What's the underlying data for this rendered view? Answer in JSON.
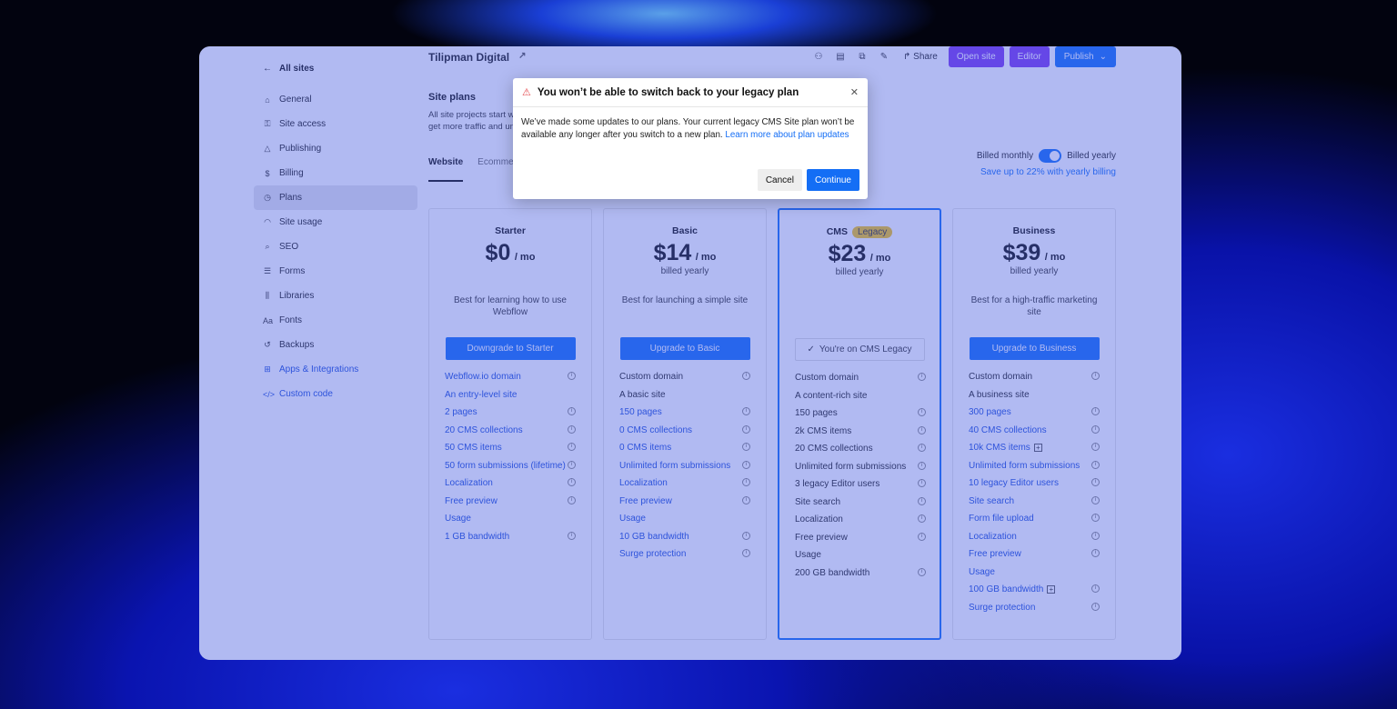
{
  "sidebar": {
    "back_label": "All sites",
    "items": [
      {
        "label": "General",
        "icon": "home-icon",
        "glyph": "⌂"
      },
      {
        "label": "Site access",
        "icon": "key-icon",
        "glyph": "⚿"
      },
      {
        "label": "Publishing",
        "icon": "send-icon",
        "glyph": "△"
      },
      {
        "label": "Billing",
        "icon": "dollar-icon",
        "glyph": "$"
      },
      {
        "label": "Plans",
        "icon": "plans-icon",
        "glyph": "◷"
      },
      {
        "label": "Site usage",
        "icon": "gauge-icon",
        "glyph": "◠"
      },
      {
        "label": "SEO",
        "icon": "search-icon",
        "glyph": "⌕"
      },
      {
        "label": "Forms",
        "icon": "forms-icon",
        "glyph": "☰"
      },
      {
        "label": "Libraries",
        "icon": "library-icon",
        "glyph": "⫼"
      },
      {
        "label": "Fonts",
        "icon": "font-icon",
        "glyph": "Aa"
      },
      {
        "label": "Backups",
        "icon": "backup-icon",
        "glyph": "↺"
      },
      {
        "label": "Apps & Integrations",
        "icon": "apps-icon",
        "glyph": "⊞"
      },
      {
        "label": "Custom code",
        "icon": "code-icon",
        "glyph": "</>"
      }
    ]
  },
  "header": {
    "site_name": "Tilipman Digital",
    "share": "Share",
    "open_site": "Open site",
    "editor": "Editor",
    "publish": "Publish"
  },
  "section": {
    "title": "Site plans",
    "description": "All site projects start with a free plan. Upgrade to connect a custom domain, get more traffic and unlock features.",
    "tabs": [
      "Website",
      "Ecommerce"
    ]
  },
  "billing": {
    "monthly": "Billed monthly",
    "yearly": "Billed yearly",
    "note": "Save up to 22% with yearly billing",
    "yearly_selected": true
  },
  "plans": [
    {
      "name": "Starter",
      "price": "$0",
      "per": "/ mo",
      "billed": "",
      "tagline": "Best for learning how to use Webflow",
      "cta": "Downgrade to Starter",
      "features": [
        {
          "label": "Webflow.io domain",
          "info": true,
          "link": true
        },
        {
          "label": "An entry-level site",
          "info": false,
          "link": true
        },
        {
          "label": "2 pages",
          "info": true,
          "link": true
        },
        {
          "label": "20 CMS collections",
          "info": true,
          "link": true
        },
        {
          "label": "50 CMS items",
          "info": true,
          "link": true
        },
        {
          "label": "50 form submissions (lifetime)",
          "info": true,
          "link": true
        },
        {
          "label": "Localization",
          "info": true,
          "link": true
        },
        {
          "label": "Free preview",
          "info": true,
          "link": true
        },
        {
          "label": "Usage",
          "info": false,
          "link": true
        },
        {
          "label": "1 GB bandwidth",
          "info": true,
          "link": true
        }
      ]
    },
    {
      "name": "Basic",
      "price": "$14",
      "per": "/ mo",
      "billed": "billed yearly",
      "tagline": "Best for launching a simple site",
      "cta": "Upgrade to Basic",
      "features": [
        {
          "label": "Custom domain",
          "info": true,
          "link": false
        },
        {
          "label": "A basic site",
          "info": false,
          "link": false
        },
        {
          "label": "150 pages",
          "info": true,
          "link": true
        },
        {
          "label": "0 CMS collections",
          "info": true,
          "link": true
        },
        {
          "label": "0 CMS items",
          "info": true,
          "link": true
        },
        {
          "label": "Unlimited form submissions",
          "info": true,
          "link": true
        },
        {
          "label": "Localization",
          "info": true,
          "link": true
        },
        {
          "label": "Free preview",
          "info": true,
          "link": true
        },
        {
          "label": "Usage",
          "info": false,
          "link": true
        },
        {
          "label": "10 GB bandwidth",
          "info": true,
          "link": true
        },
        {
          "label": "Surge protection",
          "info": true,
          "link": true
        }
      ]
    },
    {
      "name": "CMS",
      "badge": "Legacy",
      "price": "$23",
      "per": "/ mo",
      "billed": "billed yearly",
      "tagline": "",
      "cta": "You're on CMS Legacy",
      "features": [
        {
          "label": "Custom domain",
          "info": true,
          "link": false
        },
        {
          "label": "A content-rich site",
          "info": false,
          "link": false
        },
        {
          "label": "150 pages",
          "info": true,
          "link": false
        },
        {
          "label": "2k CMS items",
          "info": true,
          "link": false
        },
        {
          "label": "20 CMS collections",
          "info": true,
          "link": false
        },
        {
          "label": "Unlimited form submissions",
          "info": true,
          "link": false
        },
        {
          "label": "3 legacy Editor users",
          "info": true,
          "link": false
        },
        {
          "label": "Site search",
          "info": true,
          "link": false
        },
        {
          "label": "Localization",
          "info": true,
          "link": false
        },
        {
          "label": "Free preview",
          "info": true,
          "link": false
        },
        {
          "label": "Usage",
          "info": false,
          "link": false
        },
        {
          "label": "200 GB bandwidth",
          "info": true,
          "link": false
        }
      ]
    },
    {
      "name": "Business",
      "price": "$39",
      "per": "/ mo",
      "billed": "billed yearly",
      "tagline": "Best for a high-traffic marketing site",
      "cta": "Upgrade to Business",
      "features": [
        {
          "label": "Custom domain",
          "info": true,
          "link": false
        },
        {
          "label": "A business site",
          "info": false,
          "link": false
        },
        {
          "label": "300 pages",
          "info": true,
          "link": true
        },
        {
          "label": "40 CMS collections",
          "info": true,
          "link": true
        },
        {
          "label": "10k CMS items",
          "info": true,
          "link": true,
          "plus": true
        },
        {
          "label": "Unlimited form submissions",
          "info": true,
          "link": true
        },
        {
          "label": "10 legacy Editor users",
          "info": true,
          "link": true
        },
        {
          "label": "Site search",
          "info": true,
          "link": true
        },
        {
          "label": "Form file upload",
          "info": true,
          "link": true
        },
        {
          "label": "Localization",
          "info": true,
          "link": true
        },
        {
          "label": "Free preview",
          "info": true,
          "link": true
        },
        {
          "label": "Usage",
          "info": false,
          "link": true
        },
        {
          "label": "100 GB bandwidth",
          "info": true,
          "link": true,
          "plus": true
        },
        {
          "label": "Surge protection",
          "info": true,
          "link": true
        }
      ]
    }
  ],
  "dialog": {
    "title": "You won’t be able to switch back to your legacy plan",
    "body": "We’ve made some updates to our plans. Your current legacy CMS Site plan won’t be available any longer after you switch to a new plan.",
    "link": "Learn more about plan updates",
    "cancel": "Cancel",
    "continue": "Continue"
  },
  "colors": {
    "accent": "#146ef5",
    "purple": "#7c3aed",
    "legacy_badge": "#f5c518",
    "warning": "#e5484d"
  }
}
